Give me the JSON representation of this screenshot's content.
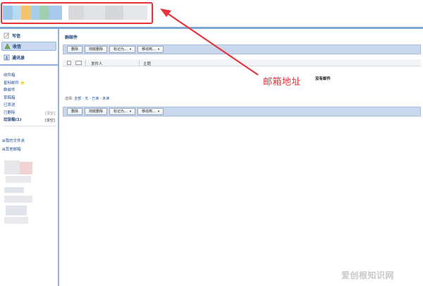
{
  "sidebar": {
    "compose_label": "写信",
    "inbox_label": "收信",
    "contacts_label": "通讯录",
    "folders": [
      {
        "label": "收件箱",
        "clear": ""
      },
      {
        "label": "星标邮件 ⭐",
        "clear": ""
      },
      {
        "label": "群邮件",
        "clear": ""
      },
      {
        "label": "草稿箱",
        "clear": ""
      },
      {
        "label": "已发送",
        "clear": ""
      },
      {
        "label": "已删除",
        "clear": "[清空]"
      },
      {
        "label": "垃圾箱(1)",
        "clear": "[清空]"
      }
    ],
    "my_folders_label": "⊞我的文件夹",
    "other_mailboxes_label": "⊞其他邮箱"
  },
  "main": {
    "title": "群邮件",
    "toolbar": {
      "delete_label": "删除",
      "perm_delete_label": "彻底删除",
      "mark_as_label": "标记为...",
      "move_to_label": "移动到...",
      "dropdown_arrow": "▾"
    },
    "table": {
      "sender_header": "发件人",
      "subject_header": "主题",
      "empty_text": "没有邮件"
    },
    "select": {
      "label": "选择:",
      "options": "全部 - 无 - 已读 - 未读"
    }
  },
  "annotation": {
    "text": "邮箱地址",
    "color": "#e8333b"
  },
  "watermark": "爱创根知识网",
  "colors": {
    "accent_blue": "#7ea8d6",
    "toolbar_bg": "#c9d8ec",
    "highlight_red": "#e8333b"
  },
  "icons": [
    "compose-icon",
    "inbox-icon",
    "contacts-icon"
  ]
}
